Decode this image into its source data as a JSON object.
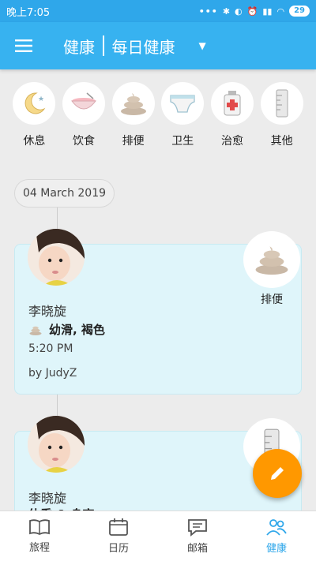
{
  "status_bar": {
    "time": "晚上7:05",
    "battery": "29"
  },
  "app_bar": {
    "title_main": "健康",
    "title_sub": "每日健康"
  },
  "categories": [
    {
      "label": "休息",
      "icon": "moon-icon"
    },
    {
      "label": "饮食",
      "icon": "bowl-icon"
    },
    {
      "label": "排便",
      "icon": "poop-icon"
    },
    {
      "label": "卫生",
      "icon": "diaper-icon"
    },
    {
      "label": "治愈",
      "icon": "medicine-icon"
    },
    {
      "label": "其他",
      "icon": "ruler-icon"
    }
  ],
  "date_chip": "04 March 2019",
  "entries": [
    {
      "child": "李晓旋",
      "type": "排便",
      "detail": "幼滑, 褐色",
      "time": "5:20 PM",
      "author": "by JudyZ"
    },
    {
      "child": "李晓旋",
      "type": "其他",
      "detail": "体重 & 身高"
    }
  ],
  "bottom_nav": [
    {
      "label": "旅程",
      "icon": "book-icon"
    },
    {
      "label": "日历",
      "icon": "calendar-icon"
    },
    {
      "label": "邮箱",
      "icon": "chat-icon"
    },
    {
      "label": "健康",
      "icon": "health-icon"
    }
  ],
  "colors": {
    "primary": "#37b2f0",
    "accent": "#ff9800",
    "card_bg": "#dff5fa"
  }
}
